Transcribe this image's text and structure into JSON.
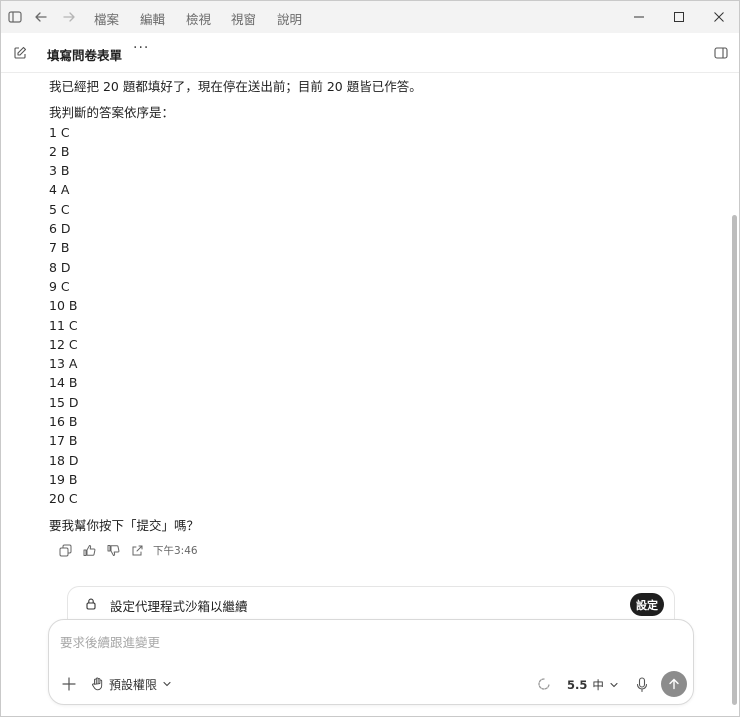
{
  "menu": [
    "檔案",
    "編輯",
    "檢視",
    "視窗",
    "說明"
  ],
  "header": {
    "title": "填寫問卷表單",
    "more": "···"
  },
  "message": {
    "intro": "我已經把 20 題都填好了，現在停在送出前；目前 20 題皆已作答。",
    "answers_heading": "我判斷的答案依序是：",
    "answers": [
      "1 C",
      "2 B",
      "3 B",
      "4 A",
      "5 C",
      "6 D",
      "7 B",
      "8 D",
      "9 C",
      "10 B",
      "11 C",
      "12 C",
      "13 A",
      "14 B",
      "15 D",
      "16 B",
      "17 B",
      "18 D",
      "19 B",
      "20 C"
    ],
    "question": "要我幫你按下「提交」嗎？",
    "time": "下午3:46"
  },
  "banner": {
    "text": "設定代理程式沙箱以繼續",
    "button": "設定"
  },
  "composer": {
    "placeholder": "要求後續跟進變更",
    "permissions": "預設權限",
    "model_version": "5.5",
    "model_level": "中"
  },
  "icons": {
    "sidebar": "sidebar-toggle-icon",
    "back": "arrow-left-icon",
    "forward": "arrow-right-icon",
    "new_chat": "compose-icon",
    "panel": "panel-right-icon",
    "copy": "copy-icon",
    "like": "thumbs-up-icon",
    "dislike": "thumbs-down-icon",
    "share": "share-icon",
    "lock": "lock-icon",
    "add": "plus-icon",
    "hand": "hand-icon",
    "mic": "mic-icon",
    "send": "arrow-up-icon"
  },
  "colors": {
    "titlebar": "#f3f3f3",
    "button_dark": "#1f1f1f",
    "send_disabled": "#8c8c8c"
  }
}
